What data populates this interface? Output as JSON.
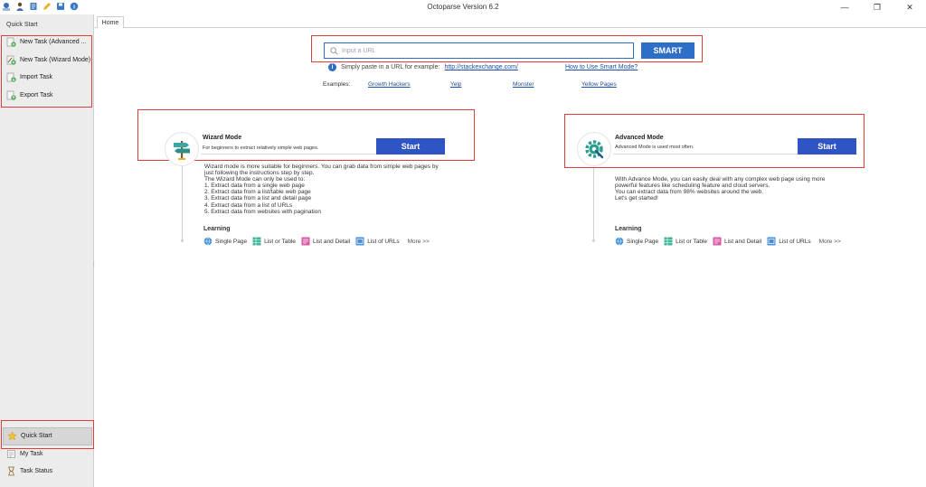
{
  "window": {
    "title": "Octoparse Version 6.2",
    "controls": {
      "minimize": "—",
      "restore": "❐",
      "close": "✕"
    }
  },
  "titlebar_icons": [
    "octoparse-logo-icon",
    "user-icon",
    "document-icon",
    "pencil-icon",
    "save-icon",
    "info-icon"
  ],
  "sidebar": {
    "header": "Quick Start",
    "top_items": [
      {
        "label": "New Task (Advanced ...",
        "icon": "new-task-advanced-icon"
      },
      {
        "label": "New Task (Wizard Mode)",
        "icon": "new-task-wizard-icon"
      },
      {
        "label": "Import Task",
        "icon": "import-task-icon"
      },
      {
        "label": "Export Task",
        "icon": "export-task-icon"
      }
    ],
    "bottom_items": [
      {
        "label": "Quick Start",
        "icon": "star-icon"
      },
      {
        "label": "My Task",
        "icon": "my-task-icon"
      },
      {
        "label": "Task Status",
        "icon": "hourglass-icon"
      }
    ],
    "splitter": "⁞"
  },
  "tabs": [
    {
      "label": "Home"
    }
  ],
  "url_bar": {
    "placeholder": "Input a URL",
    "smart_button": "SMART",
    "hint_text": "Simply paste in a URL for example:",
    "hint_link": "http://stackexchange.com/",
    "howto_link": "How to Use Smart Mode?",
    "examples_label": "Examples:",
    "examples": [
      "Growth Hackers",
      "Yelp",
      "Monster",
      "Yellow Pages"
    ]
  },
  "wizard": {
    "title": "Wizard Mode",
    "subtitle": "For beginners to extract relatively simple web pages.",
    "start": "Start",
    "desc": [
      "Wizard mode is more suitable for beginners. You can grab data from simple web pages by",
      "just following the instructions step by step.",
      "The Wizard Mode can only be used to:",
      "1. Extract data from a single web page",
      "2. Extract data from a list/table web page",
      "3. Extract data from a list and detail page",
      "4. Extract data from a list of URLs",
      "5. Extract data from websites with pagination"
    ]
  },
  "advanced": {
    "title": "Advanced Mode",
    "subtitle": "Advanced Mode is used most often.",
    "start": "Start",
    "desc": [
      "With Advance Mode, you can easily deal with any complex web page using more",
      "powerful features like scheduling feature and cloud servers.",
      "You can extract data from 98% websites around the web.",
      "Let's get started!"
    ]
  },
  "learning": {
    "title": "Learning",
    "items": [
      "Single Page",
      "List or Table",
      "List and Detail",
      "List of URLs"
    ],
    "more": "More >>"
  },
  "colors": {
    "accent": "#2d6ec9",
    "start_button": "#2f55c4",
    "highlight_border": "#e23c3c",
    "sidebar_bg": "#ececec"
  }
}
